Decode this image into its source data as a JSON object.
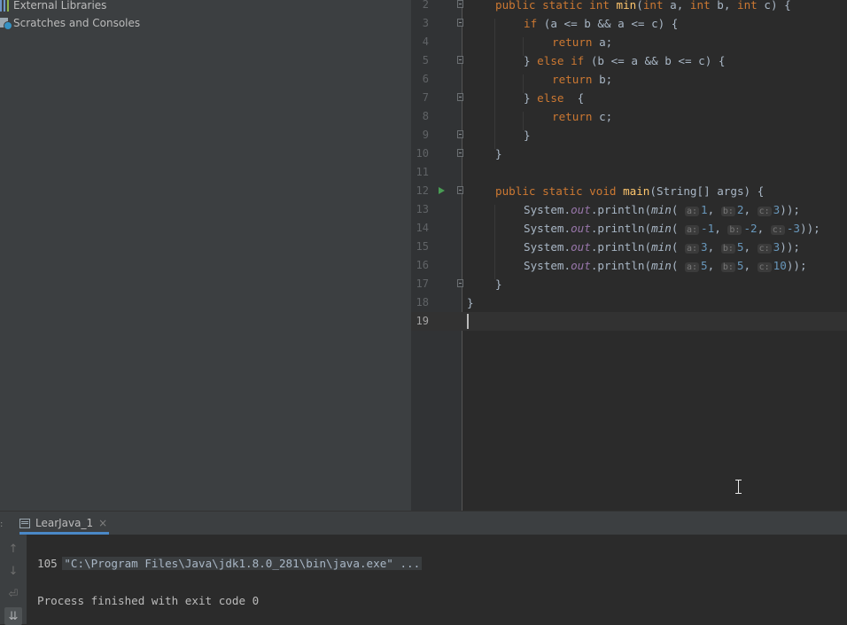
{
  "sidebar": {
    "items": [
      {
        "label": "External Libraries",
        "icon": "library-icon"
      },
      {
        "label": "Scratches and Consoles",
        "icon": "scratches-icon"
      }
    ]
  },
  "editor": {
    "lines": [
      {
        "num": "2"
      },
      {
        "num": "3"
      },
      {
        "num": "4"
      },
      {
        "num": "5"
      },
      {
        "num": "6"
      },
      {
        "num": "7"
      },
      {
        "num": "8"
      },
      {
        "num": "9"
      },
      {
        "num": "10"
      },
      {
        "num": "11"
      },
      {
        "num": "12"
      },
      {
        "num": "13"
      },
      {
        "num": "14"
      },
      {
        "num": "15"
      },
      {
        "num": "16"
      },
      {
        "num": "17"
      },
      {
        "num": "18"
      },
      {
        "num": "19"
      }
    ],
    "code": {
      "l2": {
        "a": "public static int ",
        "b": "min",
        "c": "(",
        "d": "int ",
        "e": "a, ",
        "f": "int ",
        "g": "b, ",
        "h": "int ",
        "i": "c) {"
      },
      "l3": {
        "a": "if ",
        "b": "(a <= b && a <= c) {"
      },
      "l4": {
        "a": "return ",
        "b": "a;"
      },
      "l5": {
        "a": "} ",
        "b": "else if ",
        "c": "(b <= a && b <= c) {"
      },
      "l6": {
        "a": "return ",
        "b": "b;"
      },
      "l7": {
        "a": "} ",
        "b": "else  ",
        "c": "{"
      },
      "l8": {
        "a": "return ",
        "b": "c;"
      },
      "l9": "}",
      "l10": "}",
      "l12": {
        "a": "public static void ",
        "b": "main",
        "c": "(String[] args) {"
      },
      "calls": [
        {
          "a": "1",
          "b": "2",
          "c": "3",
          "end": "));"
        },
        {
          "a": "-1",
          "b": "-2",
          "c": "-3",
          "end": "));"
        },
        {
          "a": "3",
          "b": "5",
          "c": "3",
          "end": "));"
        },
        {
          "a": "5",
          "b": "5",
          "c": "10",
          "end": "));"
        }
      ],
      "call_parts": {
        "sys": "System.",
        "out": "out",
        "println": ".println(",
        "min": "min",
        "open": "( ",
        "sep": ", "
      },
      "hints": {
        "a": "a:",
        "b": "b:",
        "c": "c:"
      },
      "l17": "}",
      "l18": "}"
    }
  },
  "run": {
    "tab_label": "LearJava_1",
    "tab_close": "×",
    "console": {
      "command": "\"C:\\Program Files\\Java\\jdk1.8.0_281\\bin\\java.exe\" ...",
      "output": "105",
      "exit": "Process finished with exit code 0"
    },
    "toolbar": {
      "up": "↑",
      "down": "↓",
      "wrap": "⏎",
      "scroll": "⇊"
    }
  },
  "colors": {
    "keyword": "#cc7832",
    "function": "#ffc66d",
    "number": "#6897bb",
    "static_field": "#9876aa",
    "text": "#a9b7c6",
    "background": "#2b2b2b",
    "panel": "#3c3f41"
  }
}
